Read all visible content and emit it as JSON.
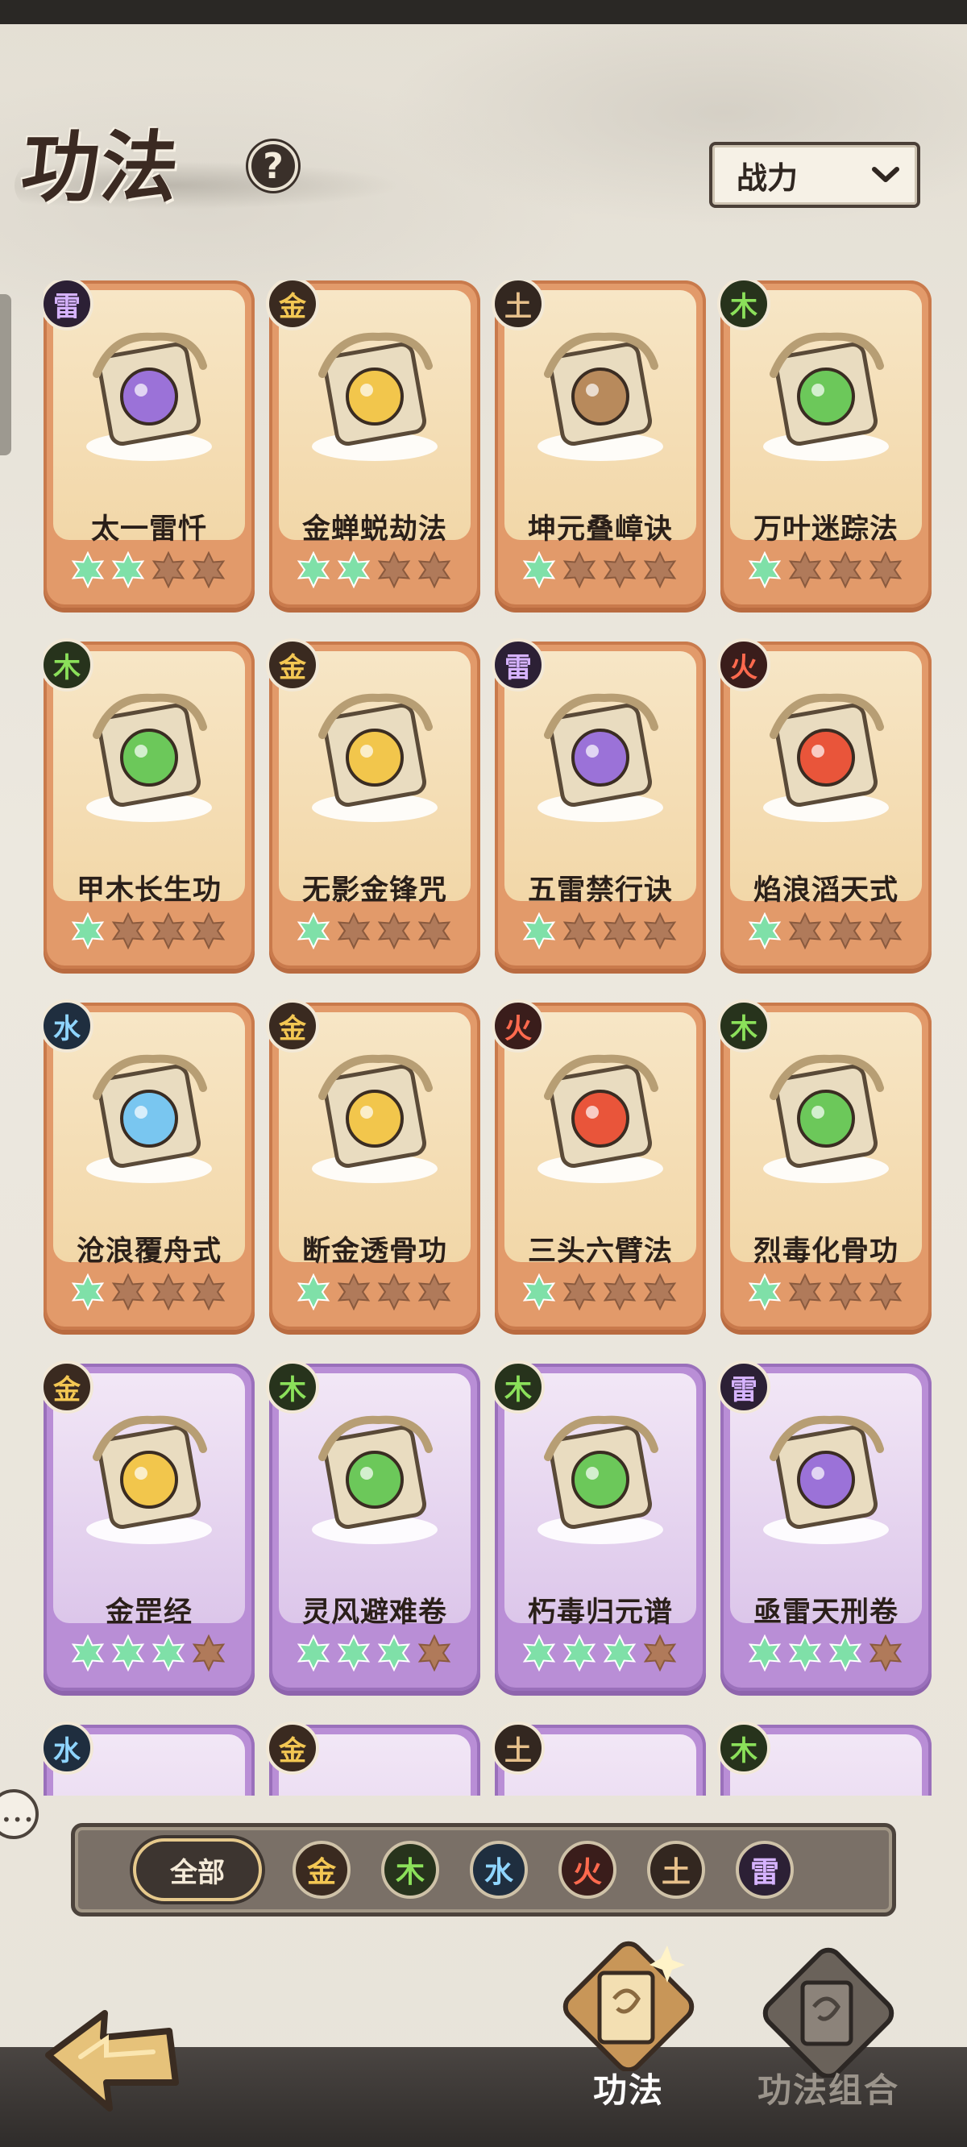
{
  "header": {
    "title": "功法",
    "help_label": "?",
    "sort": {
      "label": "战力"
    }
  },
  "skills": [
    {
      "name": "太一雷忏",
      "element": "雷",
      "tier": "orange",
      "stars": 2,
      "icon": "lightning-demon-icon"
    },
    {
      "name": "金蝉蜕劫法",
      "element": "金",
      "tier": "orange",
      "stars": 2,
      "icon": "gold-cicada-icon"
    },
    {
      "name": "坤元叠嶂诀",
      "element": "土",
      "tier": "orange",
      "stars": 1,
      "icon": "earth-spikes-icon"
    },
    {
      "name": "万叶迷踪法",
      "element": "木",
      "tier": "orange",
      "stars": 1,
      "icon": "leaf-swarm-icon"
    },
    {
      "name": "甲木长生功",
      "element": "木",
      "tier": "orange",
      "stars": 1,
      "icon": "green-tree-icon"
    },
    {
      "name": "无影金锋咒",
      "element": "金",
      "tier": "orange",
      "stars": 1,
      "icon": "golden-sword-icon"
    },
    {
      "name": "五雷禁行诀",
      "element": "雷",
      "tier": "orange",
      "stars": 1,
      "icon": "thunder-seal-icon"
    },
    {
      "name": "焰浪滔天式",
      "element": "火",
      "tier": "orange",
      "stars": 1,
      "icon": "flame-wave-icon"
    },
    {
      "name": "沧浪覆舟式",
      "element": "水",
      "tier": "orange",
      "stars": 1,
      "icon": "water-arrows-icon"
    },
    {
      "name": "断金透骨功",
      "element": "金",
      "tier": "orange",
      "stars": 1,
      "icon": "gold-fist-icon"
    },
    {
      "name": "三头六臂法",
      "element": "火",
      "tier": "orange",
      "stars": 1,
      "icon": "fire-demon-icon"
    },
    {
      "name": "烈毒化骨功",
      "element": "木",
      "tier": "orange",
      "stars": 1,
      "icon": "poison-cloud-icon"
    },
    {
      "name": "金罡经",
      "element": "金",
      "tier": "purple",
      "stars": 3,
      "icon": "gold-arrows-icon"
    },
    {
      "name": "灵风避难卷",
      "element": "木",
      "tier": "purple",
      "stars": 3,
      "icon": "green-leaf-icon"
    },
    {
      "name": "朽毒归元谱",
      "element": "木",
      "tier": "purple",
      "stars": 3,
      "icon": "poison-skull-icon"
    },
    {
      "name": "亟雷天刑卷",
      "element": "雷",
      "tier": "purple",
      "stars": 3,
      "icon": "purple-lightning-icon"
    },
    {
      "name": "",
      "element": "水",
      "tier": "purple",
      "stars": 0,
      "icon": ""
    },
    {
      "name": "",
      "element": "金",
      "tier": "purple",
      "stars": 0,
      "icon": ""
    },
    {
      "name": "",
      "element": "土",
      "tier": "purple",
      "stars": 0,
      "icon": ""
    },
    {
      "name": "",
      "element": "木",
      "tier": "purple",
      "stars": 0,
      "icon": ""
    }
  ],
  "filters": {
    "all_label": "全部",
    "elements": [
      {
        "label": "金",
        "color": "#f3c753",
        "bg": "#3a2a20"
      },
      {
        "label": "木",
        "color": "#8be05a",
        "bg": "#27331c"
      },
      {
        "label": "水",
        "color": "#8fd5ff",
        "bg": "#1f2e3f"
      },
      {
        "label": "火",
        "color": "#ff6a4e",
        "bg": "#3a1d1b"
      },
      {
        "label": "土",
        "color": "#e7c08b",
        "bg": "#332720"
      },
      {
        "label": "雷",
        "color": "#d6b3ff",
        "bg": "#2c2035"
      }
    ]
  },
  "bottom_nav": {
    "tabs": [
      {
        "label": "功法",
        "active": true
      },
      {
        "label": "功法组合",
        "active": false
      }
    ]
  },
  "colors": {
    "star_on": "#7fe0a8",
    "star_off": "#b07a5a"
  }
}
